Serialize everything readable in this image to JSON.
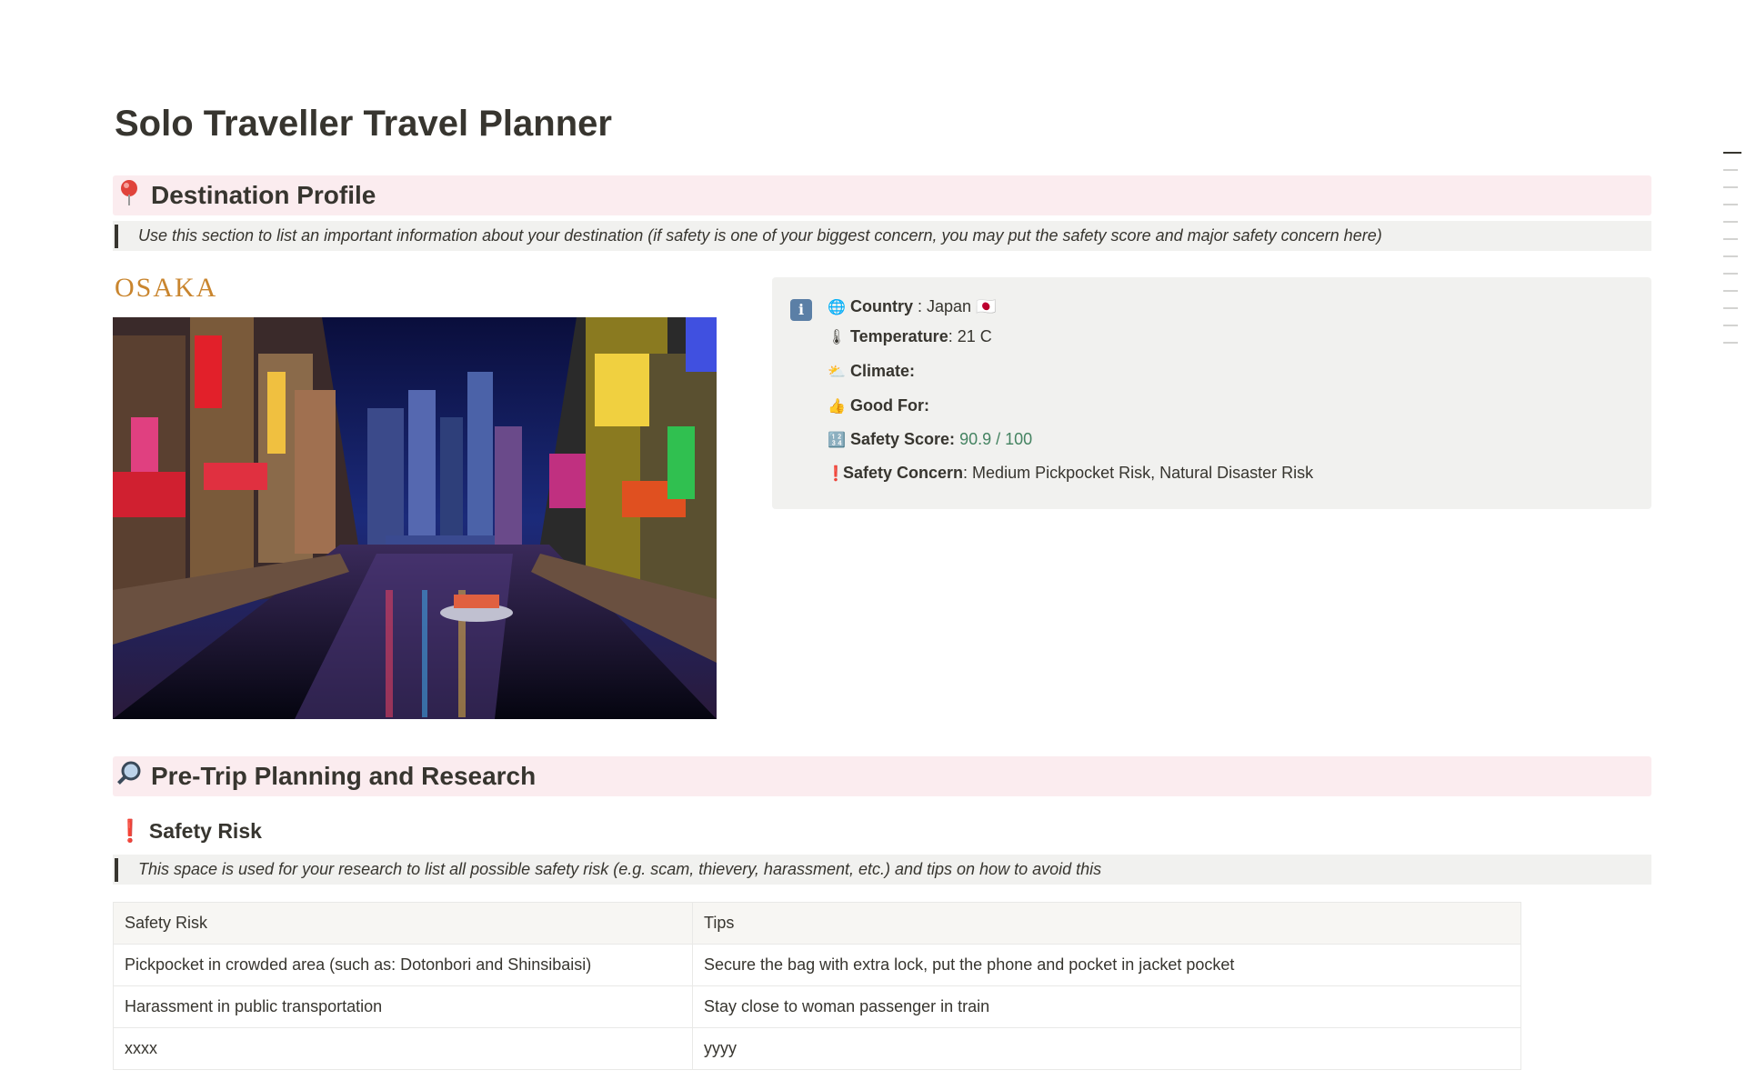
{
  "page": {
    "title": "Solo Traveller Travel Planner"
  },
  "destination_profile": {
    "heading_icon": "pin-icon",
    "heading": "Destination Profile",
    "note": "Use this section to list an important information about your destination (if safety is one of your biggest concern, you may put the safety score and major safety concern here)",
    "city_label": "OSAKA",
    "image_description": "Osaka Dotonbori canal at night",
    "facts": {
      "country_label": "Country",
      "country_sep": " : ",
      "country_value": "Japan 🇯🇵",
      "temperature_label": "Temperature",
      "temperature_value": ": 21 C",
      "climate_label": "Climate:",
      "good_for_label": "Good For:",
      "safety_score_label": "Safety Score:",
      "safety_score_value": "90.9 / 100",
      "safety_concern_label": "Safety Concern",
      "safety_concern_value": ": Medium Pickpocket Risk, Natural Disaster Risk"
    }
  },
  "pre_trip": {
    "heading": "Pre-Trip Planning and Research",
    "safety_risk": {
      "heading": "Safety Risk",
      "note": "This space is used for your research to list all possible safety risk (e.g. scam, thievery, harassment, etc.) and tips on how to avoid this",
      "table": {
        "headers": [
          "Safety Risk",
          "Tips"
        ],
        "rows": [
          [
            "Pickpocket in crowded area (such as: Dotonbori and Shinsibaisi)",
            "Secure the bag with extra lock, put the phone and pocket in jacket pocket"
          ],
          [
            "Harassment in public transportation",
            "Stay close to woman passenger in train"
          ],
          [
            "xxxx",
            "yyyy"
          ]
        ]
      }
    }
  },
  "colors": {
    "heading_bg": "#fbecef",
    "quote_bg": "#f1f1ef",
    "callout_bg": "#f1f1ef",
    "score_green": "#448361",
    "city_gold": "#c9852e"
  }
}
